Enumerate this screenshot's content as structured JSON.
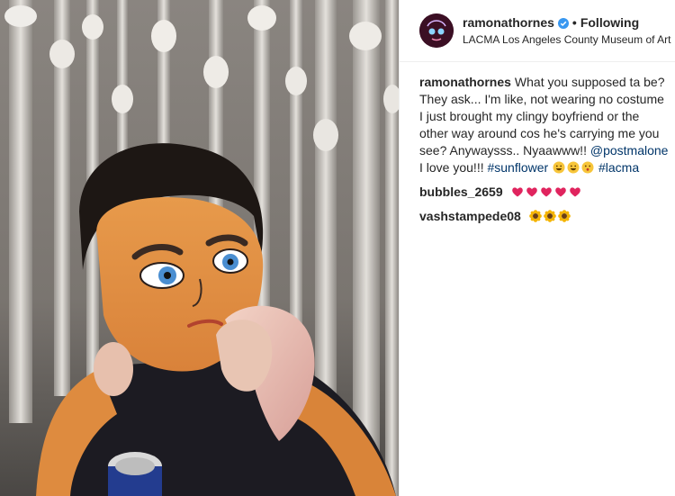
{
  "header": {
    "username": "ramonathornes",
    "dot": "•",
    "follow_status": "Following",
    "location": "LACMA Los Angeles County Museum of Art"
  },
  "caption": {
    "username": "ramonathornes",
    "text": "What you supposed ta be? They ask... I'm like, not wearing no costume I just brought my clingy boyfriend or the other way around cos he's carrying me you see? Anywaysss.. Nyaawww!! ",
    "mention": "@postmalone",
    "text2": " I love you!!! ",
    "hashtag1": "#sunflower",
    "hashtag2": "#lacma"
  },
  "comments": [
    {
      "username": "bubbles_2659",
      "emoji": "red-heart x5"
    },
    {
      "username": "vashstampede08",
      "emoji": "sunflower x3"
    }
  ],
  "colors": {
    "link": "#003569",
    "text": "#262626",
    "verified": "#3897f0",
    "heart": "#e0245e"
  }
}
